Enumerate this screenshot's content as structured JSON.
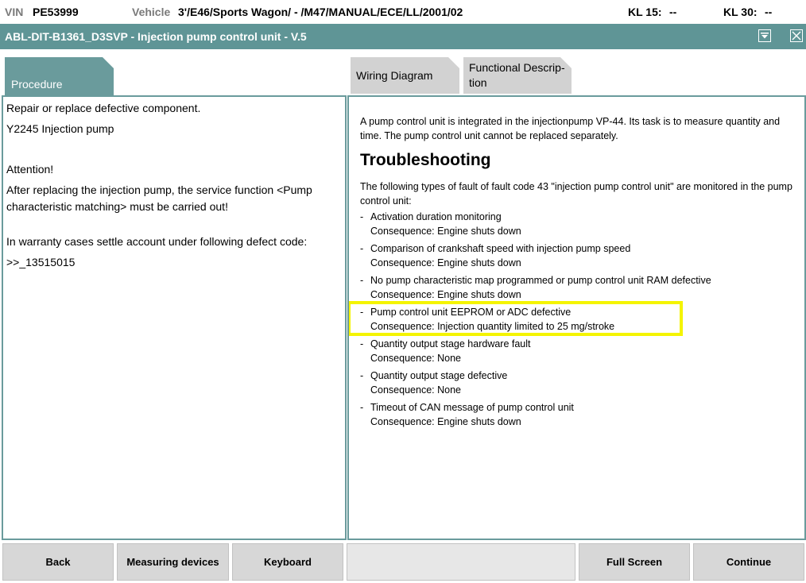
{
  "infobar": {
    "vin_label": "VIN",
    "vin_value": "PE53999",
    "vehicle_label": "Vehicle",
    "vehicle_value": "3'/E46/Sports Wagon/ - /M47/MANUAL/ECE/LL/2001/02",
    "kl15_label": "KL 15:",
    "kl15_value": "--",
    "kl30_label": "KL 30:",
    "kl30_value": "--"
  },
  "titlebar": {
    "title": "ABL-DIT-B1361_D3SVP - Injection pump control unit - V.5",
    "menu_icon": "dropdown-icon",
    "close_icon": "close-icon"
  },
  "tabs": [
    {
      "label": "Procedure",
      "active": true
    },
    {
      "label": "Wiring Diagram",
      "active": false
    },
    {
      "label_line1": "Functional Descrip-",
      "label_line2": "tion",
      "active": false
    }
  ],
  "left_panel": {
    "line1": "Repair or replace defective component.",
    "line2": "Y2245 Injection pump",
    "attention": "Attention!",
    "attention_text": "After replacing the injection pump, the service function <Pump characteristic matching> must be carried out!",
    "warranty": "In warranty cases settle account under following defect code:",
    "defect_code": ">>_13515015"
  },
  "right_panel": {
    "intro": "A pump control unit is integrated in the injectionpump VP-44. Its task is to measure quantity and time. The pump control unit cannot be replaced separately.",
    "heading": "Troubleshooting",
    "lead": "The following types of fault of fault code 43 \"injection pump control unit\" are monitored in the pump control unit:",
    "faults": [
      {
        "name": "Activation duration monitoring",
        "consequence": "Consequence: Engine shuts down"
      },
      {
        "name": "Comparison of crankshaft speed with injection pump speed",
        "consequence": "Consequence: Engine shuts down"
      },
      {
        "name": "No pump characteristic map programmed or pump control unit RAM defective",
        "consequence": "Consequence: Engine shuts down"
      },
      {
        "name": "Pump control unit EEPROM or ADC defective",
        "consequence": "Consequence: Injection quantity limited to 25 mg/stroke"
      },
      {
        "name": "Quantity output stage hardware fault",
        "consequence": "Consequence: None"
      },
      {
        "name": "Quantity output stage defective",
        "consequence": "Consequence: None"
      },
      {
        "name": "Timeout of CAN message of pump control unit",
        "consequence": "Consequence: Engine shuts down"
      }
    ],
    "dash": "-"
  },
  "bottombar": {
    "back": "Back",
    "measuring": "Measuring devices",
    "keyboard": "Keyboard",
    "fullscreen": "Full Screen",
    "continue": "Continue"
  },
  "colors": {
    "teal": "#5f9596",
    "tab_active": "#6a9b9c",
    "highlight": "#f4f400",
    "button": "#d7d7d7"
  }
}
